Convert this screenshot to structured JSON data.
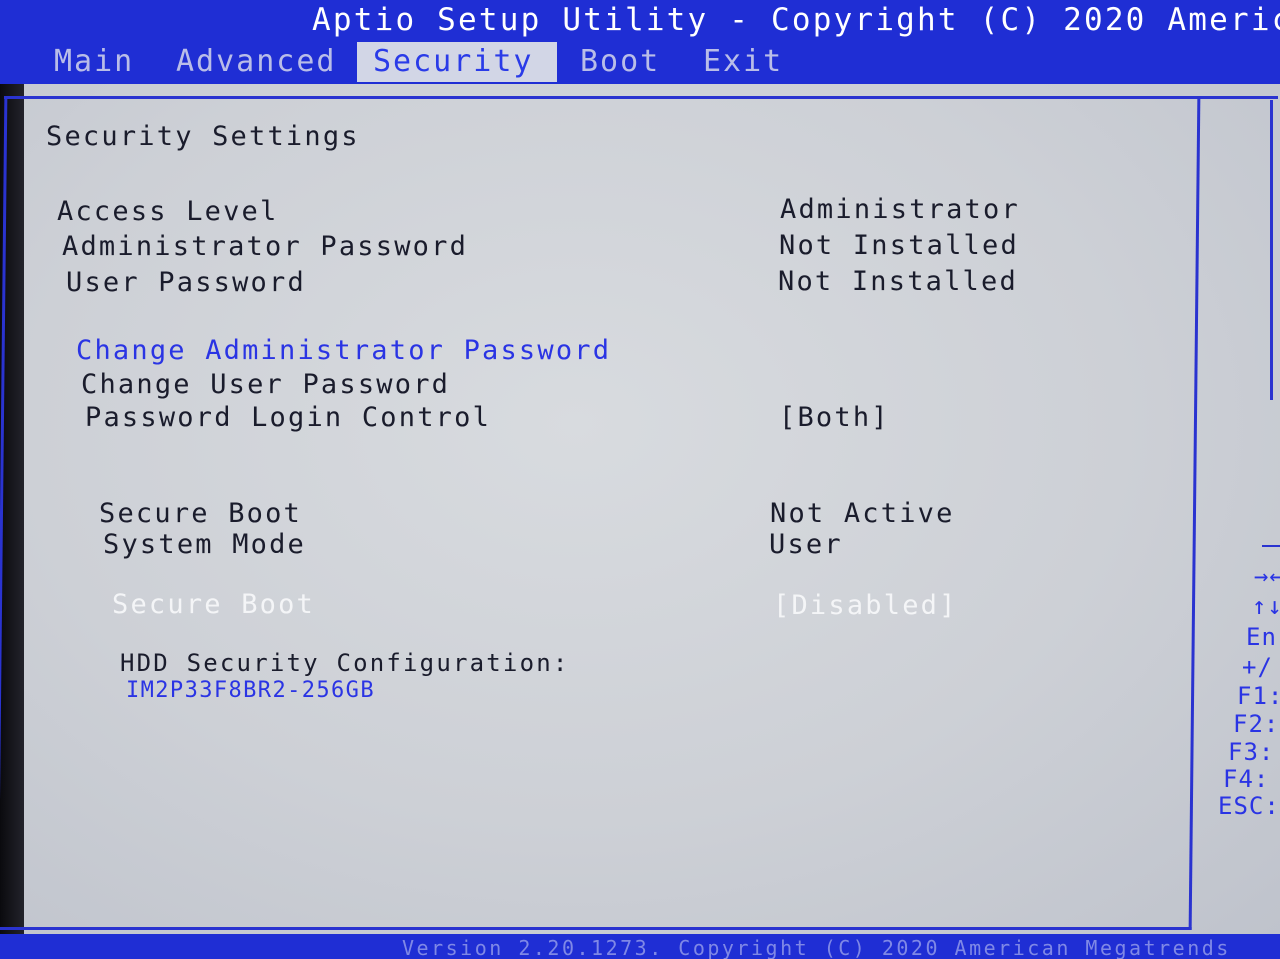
{
  "header": {
    "title": "Aptio Setup Utility - Copyright (C) 2020 Americ",
    "tabs": [
      "Main",
      "Advanced",
      "Security",
      "Boot",
      "Exit"
    ],
    "active_tab": "Security"
  },
  "security": {
    "section_title": "Security Settings",
    "access_level_label": "Access Level",
    "access_level_value": "Administrator",
    "admin_password_label": "Administrator Password",
    "admin_password_value": "Not Installed",
    "user_password_label": "User Password",
    "user_password_value": "Not Installed",
    "change_admin_password": "Change Administrator Password",
    "change_user_password": "Change User Password",
    "password_login_control_label": "Password Login Control",
    "password_login_control_value": "[Both]",
    "secure_boot_status_label": "Secure Boot",
    "secure_boot_status_value": "Not Active",
    "system_mode_label": "System Mode",
    "system_mode_value": "User",
    "secure_boot_option_label": "Secure Boot",
    "secure_boot_option_value": "[Disabled]",
    "hdd_security_label": "HDD Security Configuration:",
    "hdd_device": "IM2P33F8BR2-256GB"
  },
  "help": {
    "keys": [
      "→←",
      "↑↓",
      "En",
      "+/",
      "F1:",
      "F2:",
      "F3:",
      "F4:",
      "ESC:"
    ]
  },
  "footer": {
    "text": "Version 2.20.1273. Copyright (C) 2020 American Megatrends"
  },
  "colors": {
    "title_bar": "#1f2ed4",
    "panel_background": "#d2d6e6",
    "highlight_text": "#2a34e4",
    "normal_text": "#1a1c2c"
  }
}
